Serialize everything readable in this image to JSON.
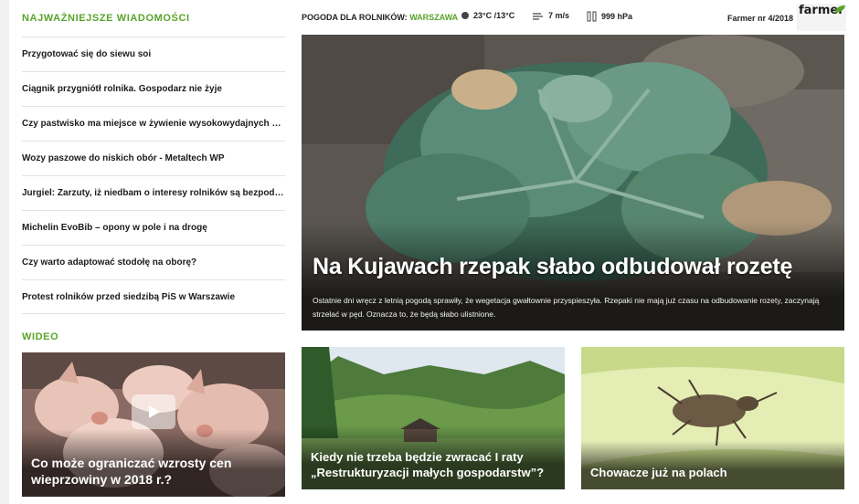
{
  "news": {
    "section_title": "NAJWAŻNIEJSZE WIADOMOŚCI",
    "items": [
      "Przygotować się do siewu soi",
      "Ciągnik przygniótł rolnika. Gospodarz nie żyje",
      "Czy pastwisko ma miejsce w żywienie wysokowydajnych krów?",
      "Wozy paszowe do niskich obór - Metaltech WP",
      "Jurgiel: Zarzuty, iż niedbam o interesy rolników są bezpodstawne",
      "Michelin EvoBib – opony w pole i na drogę",
      "Czy warto adaptować stodołę na oborę?",
      "Protest rolników przed siedzibą PiS w Warszawie"
    ]
  },
  "video": {
    "section_title": "WIDEO",
    "caption": "Co może ograniczać wzrosty cen wieprzowiny w 2018 r.?",
    "play_icon": "play-icon"
  },
  "weather": {
    "label": "POGODA DLA ROLNIKÓW:",
    "city": "WARSZAWA",
    "temperature": "23°C /13°C",
    "wind": "7 m/s",
    "pressure": "999 hPa"
  },
  "farmer": {
    "issue": "Farmer nr 4/2018",
    "logo_text": "farmer"
  },
  "hero": {
    "title": "Na Kujawach rzepak słabo odbudował rozetę",
    "lead": "Ostatnie dni wręcz z letnią pogodą sprawiły, że wegetacja gwałtownie przyspieszyła. Rzepaki nie mają już czasu na odbudowanie rozety, zaczynają strzelać w pęd. Oznacza to, że będą słabo ulistnione."
  },
  "cards": [
    {
      "caption": "Kiedy nie trzeba będzie zwracać I raty „Restrukturyzacji małych gospodarstw”?"
    },
    {
      "caption": "Chowacze już na polach"
    }
  ],
  "colors": {
    "accent": "#5aa32a",
    "text": "#1c1c1c",
    "divider": "#e3e3e3"
  }
}
